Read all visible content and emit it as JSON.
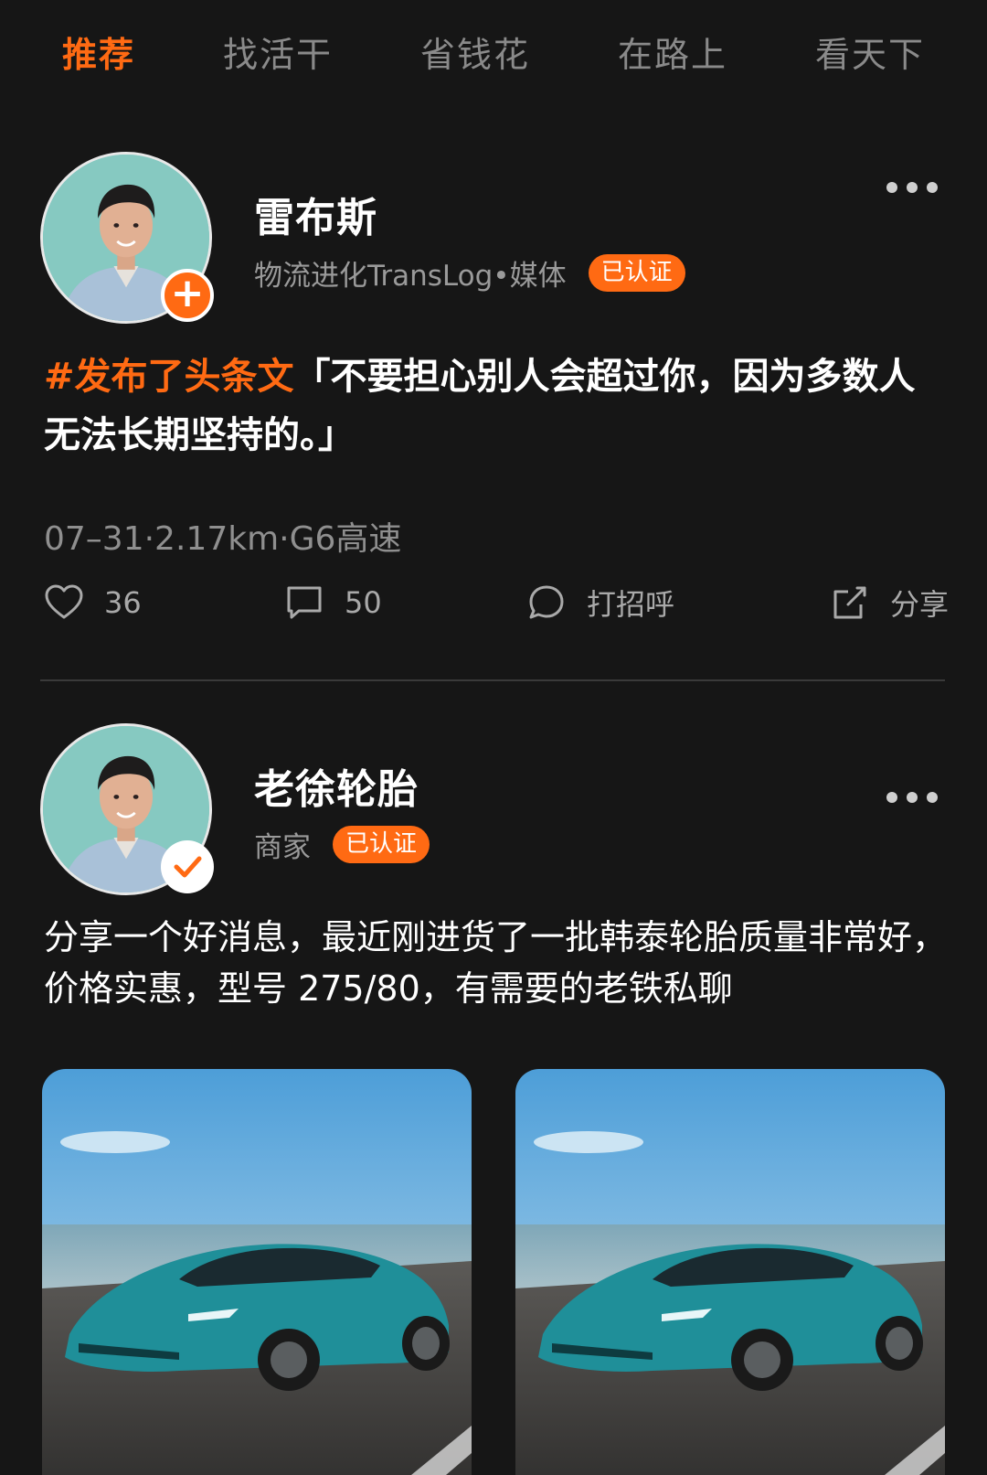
{
  "tabs": [
    {
      "label": "推荐"
    },
    {
      "label": "找活干"
    },
    {
      "label": "省钱花"
    },
    {
      "label": "在路上"
    },
    {
      "label": "看天下"
    }
  ],
  "active_tab": "推荐",
  "posts": [
    {
      "author": "雷布斯",
      "subtitle": "物流进化TransLog•媒体",
      "verified_label": "已认证",
      "avatar_badge": "plus-icon",
      "hashtag": "#发布了头条文",
      "text": "「不要担心别人会超过你，因为多数人无法长期坚持的。」",
      "info": "07–31·2.17km·G6高速",
      "likes": "36",
      "comments": "50",
      "greet_label": "打招呼",
      "share_label": "分享"
    },
    {
      "author": "老徐轮胎",
      "subtitle": "商家",
      "verified_label": "已认证",
      "avatar_badge": "check-icon",
      "text": "分享一个好消息，最近刚进货了一批韩泰轮胎质量非常好，价格实惠，型号 275/80，有需要的老铁私聊"
    }
  ],
  "colors": {
    "background": "#161616",
    "accent": "#ff6a13",
    "muted_text": "#8f8f8f"
  }
}
